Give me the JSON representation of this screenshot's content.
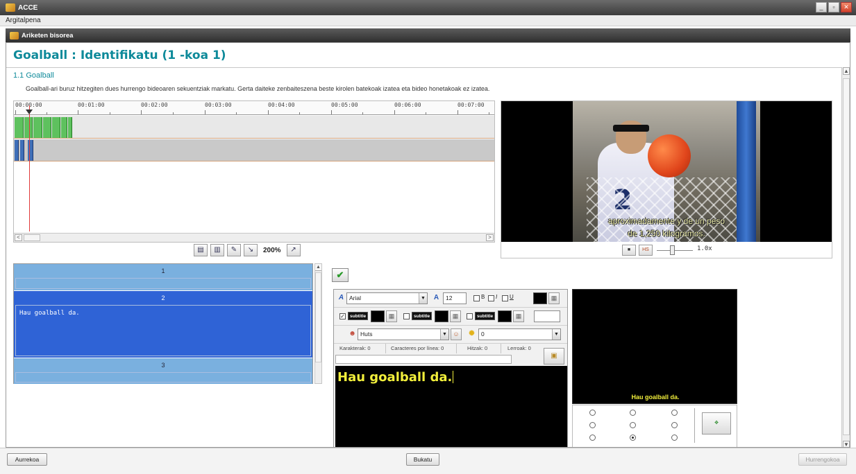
{
  "window": {
    "title": "ACCE",
    "minimize": "_",
    "restore": "▫",
    "close": "✕"
  },
  "menu": {
    "item1": "Argitalpena"
  },
  "inner": {
    "title": "Ariketen bisorea"
  },
  "page": {
    "title": "Goalball : Identifikatu (1 -koa 1)",
    "section": "1.1 Goalball",
    "instructions": "Goalball-ari buruz hitzegiten dues hurrengo bideoaren sekuentziak markatu. Gerta daiteke zenbaiteszena beste kirolen batekoak izatea eta bideo honetakoak ez izatea."
  },
  "timeline": {
    "ticks": [
      "00:00:00",
      "00:01:00",
      "00:02:00",
      "00:03:00",
      "00:04:00",
      "00:05:00",
      "00:06:00",
      "00:07:00"
    ],
    "zoom": "200%",
    "scroll_left": "<",
    "scroll_right": ">"
  },
  "video": {
    "burned_sub_1": "aproximadamente y de un peso",
    "burned_sub_2": "de 1,250 kilogramos.",
    "speed": "1.0x",
    "btn_hs": "HS"
  },
  "subtitles": {
    "items": [
      {
        "number": "1",
        "text": ""
      },
      {
        "number": "2",
        "text": "Hau goalball da."
      },
      {
        "number": "3",
        "text": ""
      }
    ]
  },
  "editor": {
    "font": "Arial",
    "size": "12",
    "bold": "B",
    "italic": "I",
    "underline": "U",
    "subtitle_tag": "subtitle",
    "speaker": "Huts",
    "effect": "0",
    "counters": {
      "chars": "Karakterak: 0",
      "chars_per_line": "Caracteres por línea: 0",
      "words": "Hitzak: 0",
      "lines": "Lerroak: 0"
    },
    "text": "Hau goalball da.",
    "text_color": "#f1ee3b"
  },
  "preview": {
    "text": "Hau goalball da."
  },
  "nav": {
    "prev": "Aurrekoa",
    "finish": "Bukatu",
    "next": "Hurrengokoa"
  }
}
